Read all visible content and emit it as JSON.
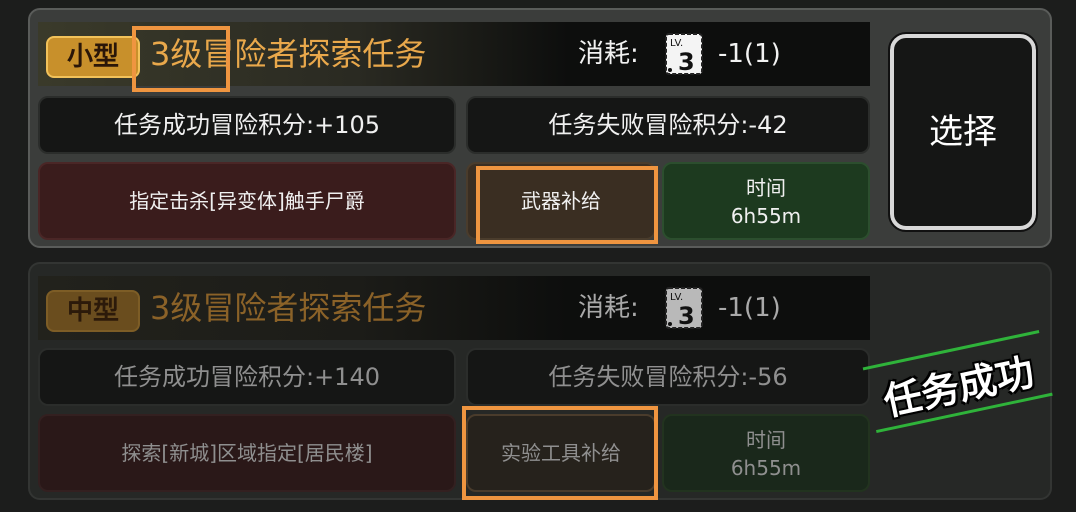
{
  "missions": [
    {
      "size_badge": "小型",
      "title": "3级冒险者探索任务",
      "cost_label": "消耗:",
      "cost_value": "-1(1)",
      "success_points": "任务成功冒险积分:+105",
      "fail_points": "任务失败冒险积分:-42",
      "requirement": "指定击杀[异变体]触手尸爵",
      "reward": "武器补给",
      "time_label": "时间",
      "time_value": "6h55m",
      "select_label": "选择"
    },
    {
      "size_badge": "中型",
      "title": "3级冒险者探索任务",
      "cost_label": "消耗:",
      "cost_value": "-1(1)",
      "success_points": "任务成功冒险积分:+140",
      "fail_points": "任务失败冒险积分:-56",
      "requirement": "探索[新城]区域指定[居民楼]",
      "reward": "实验工具补给",
      "time_label": "时间",
      "time_value": "6h55m",
      "status_stamp": "任务成功"
    }
  ],
  "icons": {
    "cost": "level-ticket-icon"
  },
  "colors": {
    "highlight": "#ef9540",
    "accent_gold": "#e9a84b",
    "success_green": "#2fb33a"
  }
}
